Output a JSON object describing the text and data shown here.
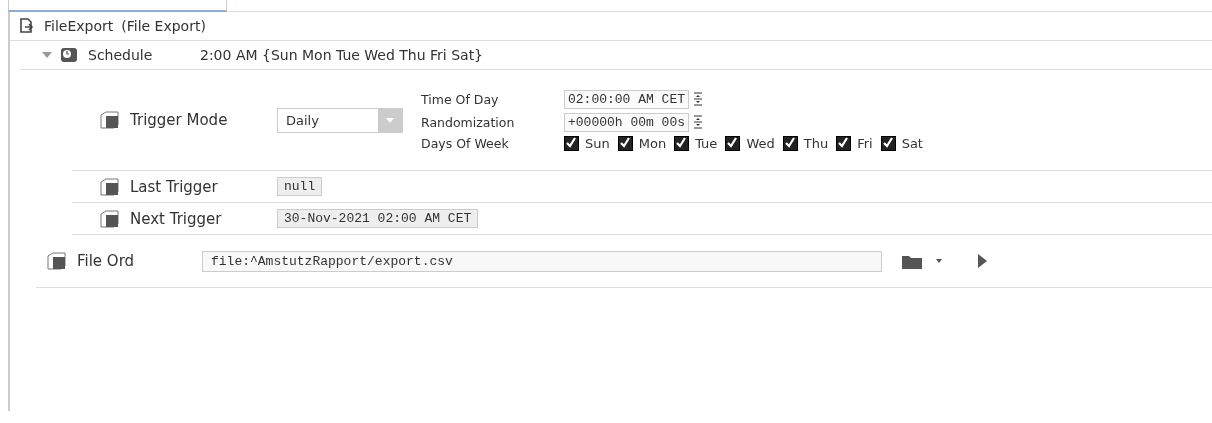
{
  "header": {
    "title": "FileExport",
    "subtitle": "(File Export)"
  },
  "schedule": {
    "expanded": true,
    "label": "Schedule",
    "value": "2:00 AM {Sun Mon Tue Wed Thu Fri Sat}",
    "trigger_mode": {
      "label": "Trigger Mode",
      "value": "Daily"
    },
    "time_of_day": {
      "label": "Time Of Day",
      "value": "02:00:00 AM CET"
    },
    "randomization": {
      "label": "Randomization",
      "value": "+00000h 00m 00s"
    },
    "days_of_week": {
      "label": "Days Of Week",
      "days": [
        {
          "label": "Sun",
          "checked": true
        },
        {
          "label": "Mon",
          "checked": true
        },
        {
          "label": "Tue",
          "checked": true
        },
        {
          "label": "Wed",
          "checked": true
        },
        {
          "label": "Thu",
          "checked": true
        },
        {
          "label": "Fri",
          "checked": true
        },
        {
          "label": "Sat",
          "checked": true
        }
      ]
    },
    "last_trigger": {
      "label": "Last Trigger",
      "value": "null"
    },
    "next_trigger": {
      "label": "Next Trigger",
      "value": "30-Nov-2021 02:00 AM CET"
    }
  },
  "file_ord": {
    "label": "File Ord",
    "value": "file:^AmstutzRapport/export.csv"
  }
}
